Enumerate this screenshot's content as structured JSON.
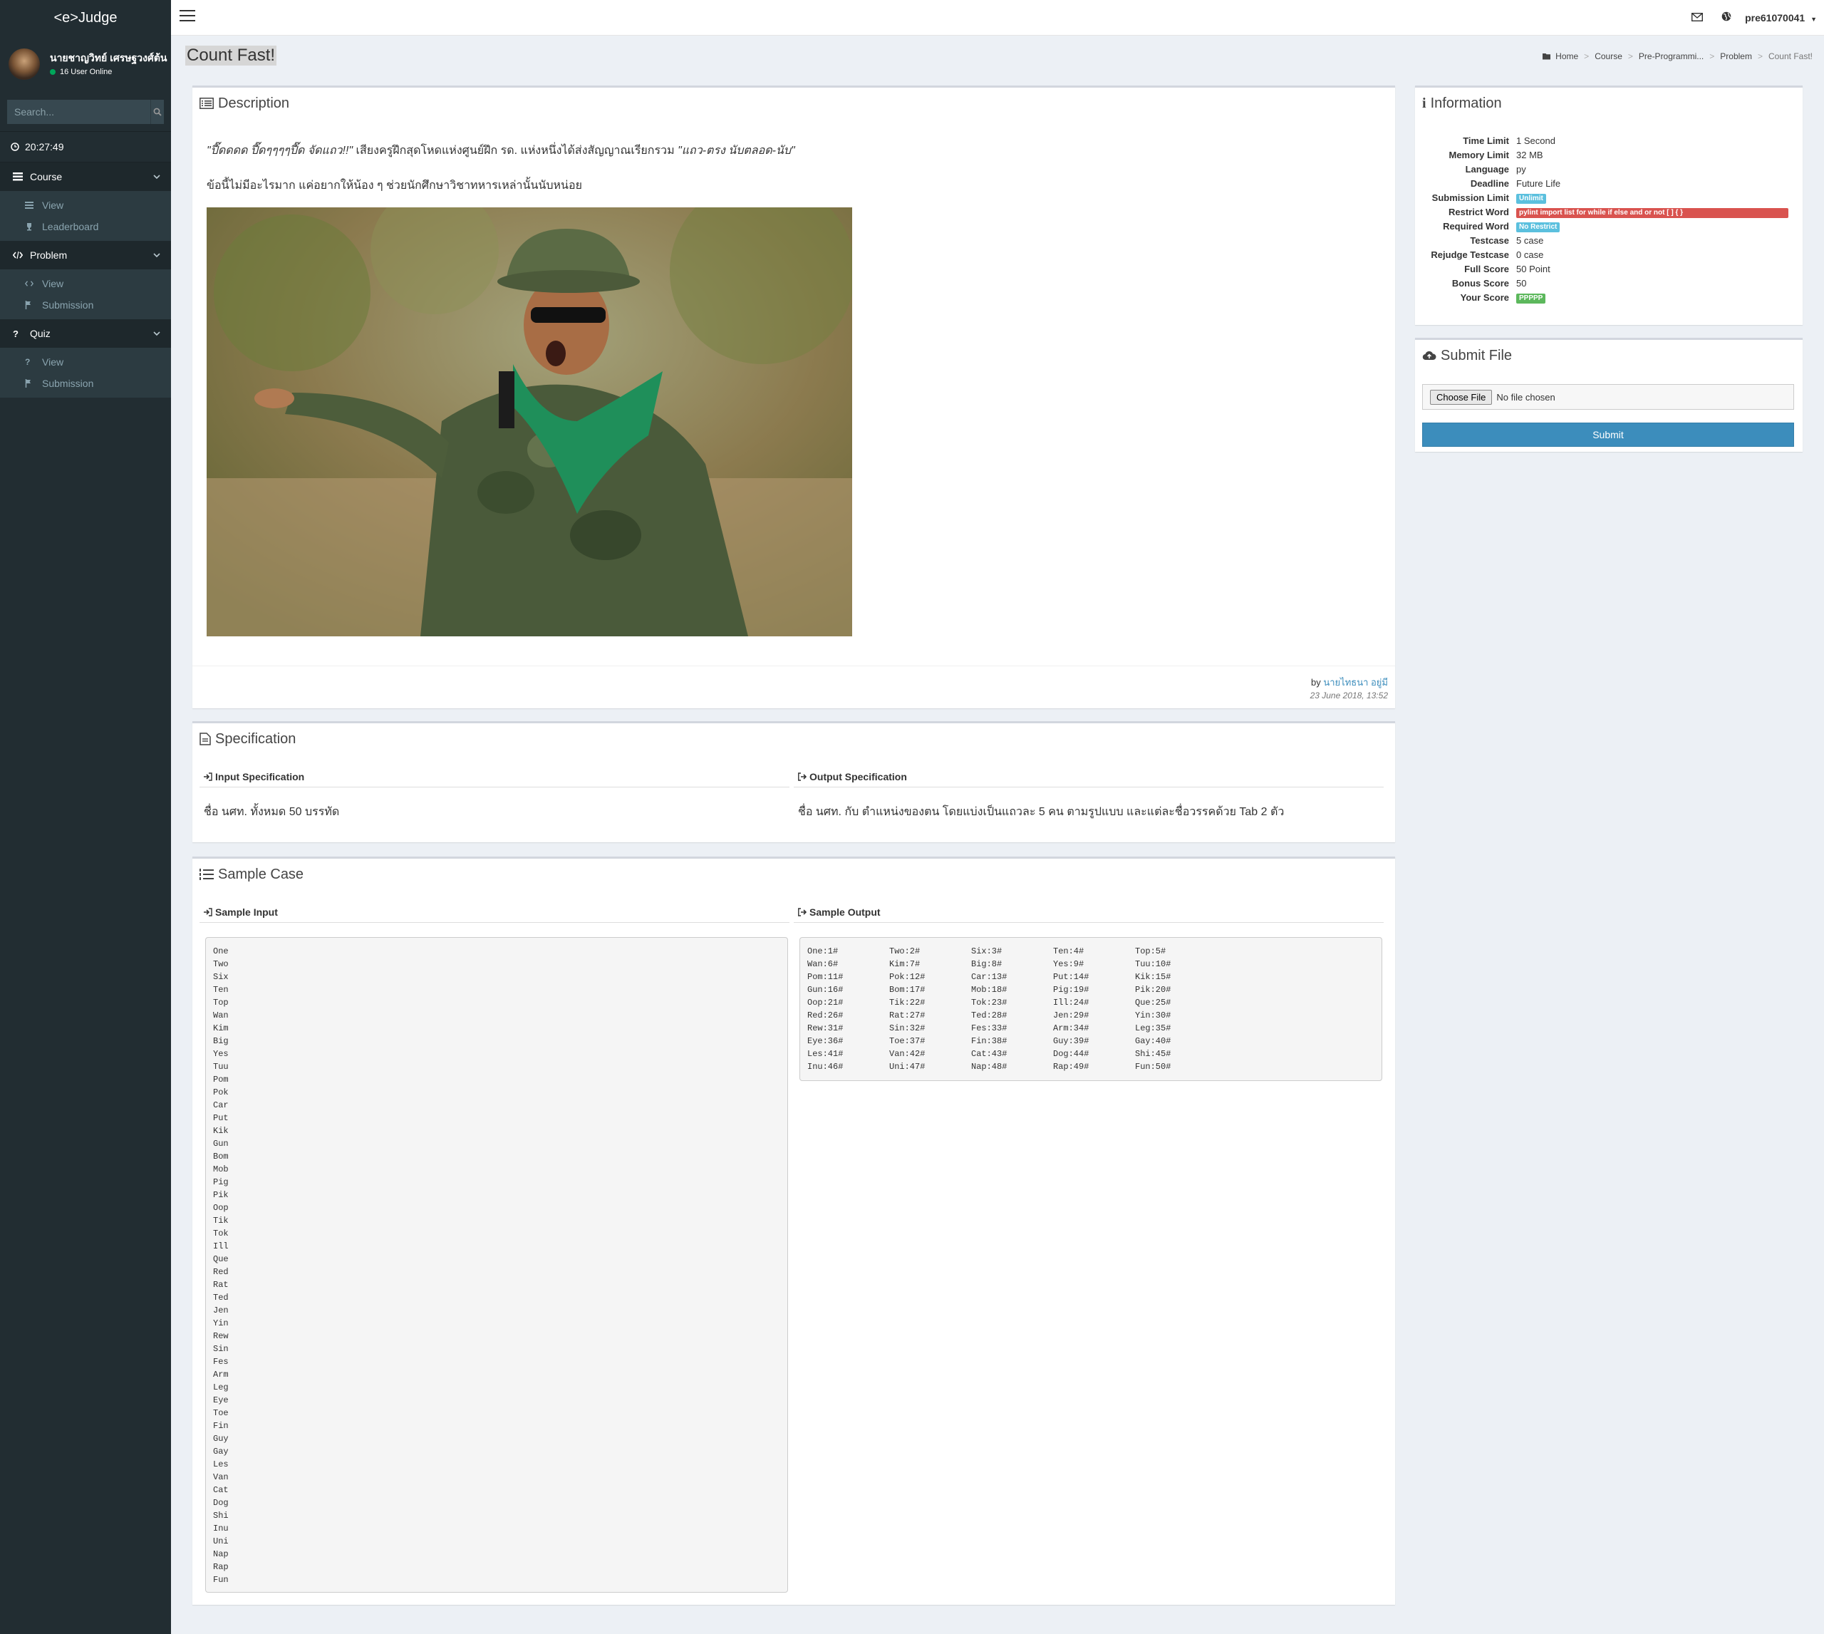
{
  "brand": "<e>Judge",
  "user": {
    "name": "นายชาญวิทย์ เศรษฐวงศ์ต้น",
    "online_text": "16 User Online"
  },
  "search": {
    "placeholder": "Search..."
  },
  "clock": "20:27:49",
  "menu": {
    "course": {
      "label": "Course",
      "items": [
        "View",
        "Leaderboard"
      ]
    },
    "problem": {
      "label": "Problem",
      "items": [
        "View",
        "Submission"
      ]
    },
    "quiz": {
      "label": "Quiz",
      "items": [
        "View",
        "Submission"
      ]
    }
  },
  "topbar": {
    "username": "pre61070041"
  },
  "page": {
    "title": "Count Fast!"
  },
  "breadcrumb": [
    "Home",
    "Course",
    "Pre-Programmi...",
    "Problem",
    "Count Fast!"
  ],
  "description": {
    "header": "Description",
    "quote1": "\"ปี๊ดดดด ปี๊ดๆๆๆๆปี๊ด จัดแถว!!\"",
    "line1_mid": " เสียงครูฝึกสุดโหดแห่งศูนย์ฝึก รด. แห่งหนึ่งได้ส่งสัญญาณเรียกรวม ",
    "quote2": "\"แถว-ตรง นับตลอด-นับ\"",
    "line2": "ข้อนี้ไม่มีอะไรมาก แค่อยากให้น้อง ๆ ช่วยนักศึกษาวิชาทหารเหล่านั้นนับหน่อย",
    "by_label": "by",
    "author": "นายไทธนา อยู่มี",
    "date": "23 June 2018, 13:52"
  },
  "specification": {
    "header": "Specification",
    "input_title": "Input Specification",
    "input_text": "ชื่อ นศท. ทั้งหมด 50 บรรทัด",
    "output_title": "Output Specification",
    "output_text": "ชื่อ นศท. กับ ตำแหน่งของตน โดยแบ่งเป็นแถวละ 5 คน ตามรูปแบบ และแต่ละชื่อวรรคด้วย Tab 2 ตัว"
  },
  "sample": {
    "header": "Sample Case",
    "input_title": "Sample Input",
    "output_title": "Sample Output",
    "input_lines": [
      "One",
      "Two",
      "Six",
      "Ten",
      "Top",
      "Wan",
      "Kim",
      "Big",
      "Yes",
      "Tuu",
      "Pom",
      "Pok",
      "Car",
      "Put",
      "Kik",
      "Gun",
      "Bom",
      "Mob",
      "Pig",
      "Pik",
      "Oop",
      "Tik",
      "Tok",
      "Ill",
      "Que",
      "Red",
      "Rat",
      "Ted",
      "Jen",
      "Yin",
      "Rew",
      "Sin",
      "Fes",
      "Arm",
      "Leg",
      "Eye",
      "Toe",
      "Fin",
      "Guy",
      "Gay",
      "Les",
      "Van",
      "Cat",
      "Dog",
      "Shi",
      "Inu",
      "Uni",
      "Nap",
      "Rap",
      "Fun"
    ],
    "output_rows": [
      [
        "One:1#",
        "Two:2#",
        "Six:3#",
        "Ten:4#",
        "Top:5#"
      ],
      [
        "Wan:6#",
        "Kim:7#",
        "Big:8#",
        "Yes:9#",
        "Tuu:10#"
      ],
      [
        "Pom:11#",
        "Pok:12#",
        "Car:13#",
        "Put:14#",
        "Kik:15#"
      ],
      [
        "Gun:16#",
        "Bom:17#",
        "Mob:18#",
        "Pig:19#",
        "Pik:20#"
      ],
      [
        "Oop:21#",
        "Tik:22#",
        "Tok:23#",
        "Ill:24#",
        "Que:25#"
      ],
      [
        "Red:26#",
        "Rat:27#",
        "Ted:28#",
        "Jen:29#",
        "Yin:30#"
      ],
      [
        "Rew:31#",
        "Sin:32#",
        "Fes:33#",
        "Arm:34#",
        "Leg:35#"
      ],
      [
        "Eye:36#",
        "Toe:37#",
        "Fin:38#",
        "Guy:39#",
        "Gay:40#"
      ],
      [
        "Les:41#",
        "Van:42#",
        "Cat:43#",
        "Dog:44#",
        "Shi:45#"
      ],
      [
        "Inu:46#",
        "Uni:47#",
        "Nap:48#",
        "Rap:49#",
        "Fun:50#"
      ]
    ]
  },
  "information": {
    "header": "Information",
    "rows": [
      {
        "label": "Time Limit",
        "value": "1 Second"
      },
      {
        "label": "Memory Limit",
        "value": "32 MB"
      },
      {
        "label": "Language",
        "value": "py"
      },
      {
        "label": "Deadline",
        "value": "Future Life"
      },
      {
        "label": "Submission Limit",
        "badge": "Unlimit",
        "badge_color": "#5bc0de"
      },
      {
        "label": "Restrict Word",
        "badge": "pylint import list for while if else and or not [ ] { }",
        "badge_color": "#d9534f"
      },
      {
        "label": "Required Word",
        "badge": "No Restrict",
        "badge_color": "#5bc0de"
      },
      {
        "label": "Testcase",
        "value": "5 case"
      },
      {
        "label": "Rejudge Testcase",
        "value": "0 case"
      },
      {
        "label": "Full Score",
        "value": "50 Point"
      },
      {
        "label": "Bonus Score",
        "value": "50"
      },
      {
        "label": "Your Score",
        "badge": "PPPPP",
        "badge_color": "#5cb85c"
      }
    ]
  },
  "submit": {
    "header": "Submit File",
    "choose_label": "Choose File",
    "no_file": "No file chosen",
    "submit_label": "Submit"
  }
}
